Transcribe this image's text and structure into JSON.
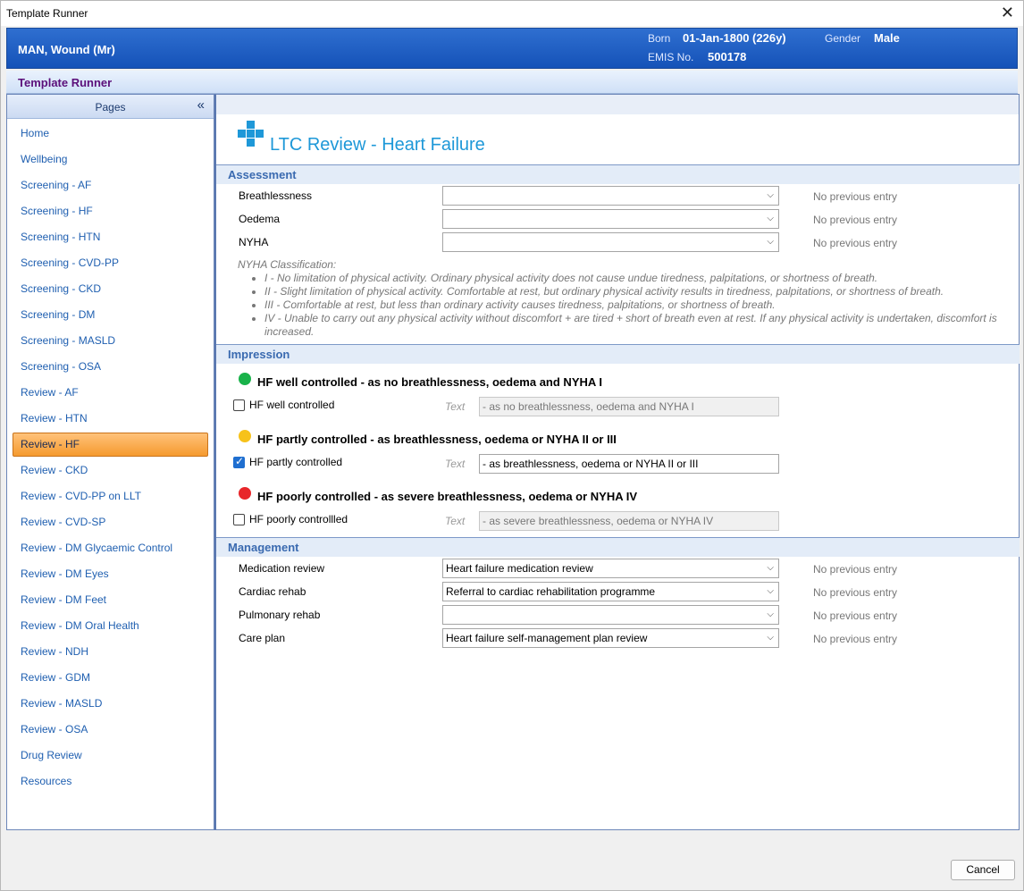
{
  "window": {
    "title": "Template Runner",
    "close_glyph": "✕"
  },
  "patient": {
    "name": "MAN, Wound (Mr)",
    "born_label": "Born",
    "born_value": "01-Jan-1800 (226y)",
    "gender_label": "Gender",
    "gender_value": "Male",
    "emis_label": "EMIS No.",
    "emis_value": "500178"
  },
  "header": {
    "title": "Template Runner"
  },
  "sidebar": {
    "title": "Pages",
    "collapse_glyph": "«",
    "items": [
      {
        "label": "Home"
      },
      {
        "label": "Wellbeing"
      },
      {
        "label": "Screening - AF"
      },
      {
        "label": "Screening - HF"
      },
      {
        "label": "Screening - HTN"
      },
      {
        "label": "Screening - CVD-PP"
      },
      {
        "label": "Screening - CKD"
      },
      {
        "label": "Screening - DM"
      },
      {
        "label": "Screening - MASLD"
      },
      {
        "label": "Screening - OSA"
      },
      {
        "label": "Review - AF"
      },
      {
        "label": "Review - HTN"
      },
      {
        "label": "Review - HF",
        "active": true
      },
      {
        "label": "Review - CKD"
      },
      {
        "label": "Review - CVD-PP on LLT"
      },
      {
        "label": "Review - CVD-SP"
      },
      {
        "label": "Review - DM Glycaemic Control"
      },
      {
        "label": "Review - DM Eyes"
      },
      {
        "label": "Review - DM Feet"
      },
      {
        "label": "Review - DM Oral Health"
      },
      {
        "label": "Review - NDH"
      },
      {
        "label": "Review - GDM"
      },
      {
        "label": "Review - MASLD"
      },
      {
        "label": "Review - OSA"
      },
      {
        "label": "Drug Review"
      },
      {
        "label": "Resources"
      }
    ]
  },
  "page": {
    "title": "LTC Review - Heart Failure",
    "logo_icon": "medical-cross-icon",
    "logo_color": "#1e98d8"
  },
  "assessment": {
    "title": "Assessment",
    "fields": [
      {
        "label": "Breathlessness",
        "value": "",
        "status": "No previous entry"
      },
      {
        "label": "Oedema",
        "value": "",
        "status": "No previous entry"
      },
      {
        "label": "NYHA",
        "value": "",
        "status": "No previous entry"
      }
    ],
    "guide_title": "NYHA Classification:",
    "guide_items": [
      "I - No limitation of physical activity. Ordinary physical activity does not cause undue tiredness, palpitations, or shortness of breath.",
      "II - Slight limitation of physical activity. Comfortable at rest, but ordinary physical activity results in tiredness, palpitations, or shortness of breath.",
      "III - Comfortable at rest, but less than ordinary activity causes tiredness, palpitations, or shortness of breath.",
      "IV - Unable to carry out any physical activity without discomfort + are tired + short of breath even at rest. If any physical activity is undertaken, discomfort is increased."
    ]
  },
  "impression": {
    "title": "Impression",
    "text_label": "Text",
    "options": [
      {
        "heading": "HF well controlled - as no breathlessness, oedema and NYHA I",
        "dot_color": "#19b24a",
        "checkbox_label": "HF well controlled",
        "checked": false,
        "text": "- as no breathlessness, oedema and NYHA I"
      },
      {
        "heading": "HF partly controlled - as breathlessness, oedema or NYHA II or III",
        "dot_color": "#f7c21a",
        "checkbox_label": "HF partly controlled",
        "checked": true,
        "text": "- as breathlessness, oedema or NYHA II or III"
      },
      {
        "heading": "HF poorly controlled - as severe breathlessness, oedema or NYHA IV",
        "dot_color": "#e8262a",
        "checkbox_label": "HF poorly controllled",
        "checked": false,
        "text": "- as severe breathlessness, oedema or NYHA IV"
      }
    ]
  },
  "management": {
    "title": "Management",
    "fields": [
      {
        "label": "Medication review",
        "value": "Heart failure medication review",
        "status": "No previous entry"
      },
      {
        "label": "Cardiac rehab",
        "value": "Referral to cardiac rehabilitation programme",
        "status": "No previous entry"
      },
      {
        "label": "Pulmonary rehab",
        "value": "",
        "status": "No previous entry"
      },
      {
        "label": "Care plan",
        "value": "Heart failure self-management plan review",
        "status": "No previous entry"
      }
    ]
  },
  "footer": {
    "cancel_label": "Cancel"
  },
  "dropdown_glyph": "⌵"
}
